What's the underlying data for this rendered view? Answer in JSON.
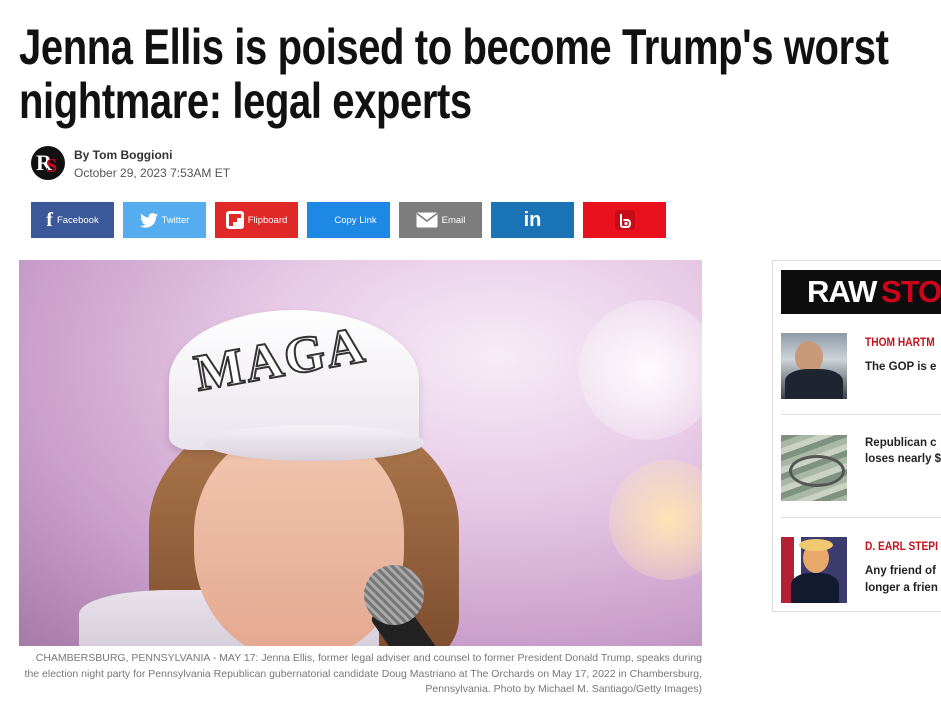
{
  "article": {
    "headline": "Jenna Ellis is poised to become Trump's worst nightmare: legal experts",
    "author": "By Tom Boggioni",
    "date": "October 29, 2023 7:53AM ET"
  },
  "share": [
    {
      "label": "Facebook",
      "icon": "facebook-icon",
      "color": "#3b5998"
    },
    {
      "label": "Twitter",
      "icon": "twitter-icon",
      "color": "#55acee"
    },
    {
      "label": "Flipboard",
      "icon": "flipboard-icon",
      "color": "#e12828"
    },
    {
      "label": "Copy Link",
      "icon": "link-icon",
      "color": "#1e88e5"
    },
    {
      "label": "Email",
      "icon": "email-icon",
      "color": "#7d7d7d"
    },
    {
      "label": "",
      "icon": "linkedin-icon",
      "color": "#1a73b4"
    },
    {
      "label": "",
      "icon": "bluesky-icon",
      "color": "#e8111d"
    }
  ],
  "hero": {
    "cap_text": "MAGA",
    "caption": "CHAMBERSBURG, PENNSYLVANIA - MAY 17: Jenna Ellis, former legal adviser and counsel to former President Donald Trump, speaks during the election night party for Pennsylvania Republican gubernatorial candidate Doug Mastriano at The Orchards on May 17, 2022 in Chambersburg, Pennsylvania. Photo by Michael M. Santiago/Getty Images)"
  },
  "sidebar": {
    "logo_raw": "RAW",
    "logo_story": "STO",
    "items": [
      {
        "author": "THOM HARTM",
        "line1": "The GOP is e",
        "line2": ""
      },
      {
        "author": "",
        "line1": "Republican c",
        "line2": "loses nearly $"
      },
      {
        "author": "D. EARL STEPI",
        "line1": "Any friend of",
        "line2": "longer a frien"
      }
    ]
  }
}
